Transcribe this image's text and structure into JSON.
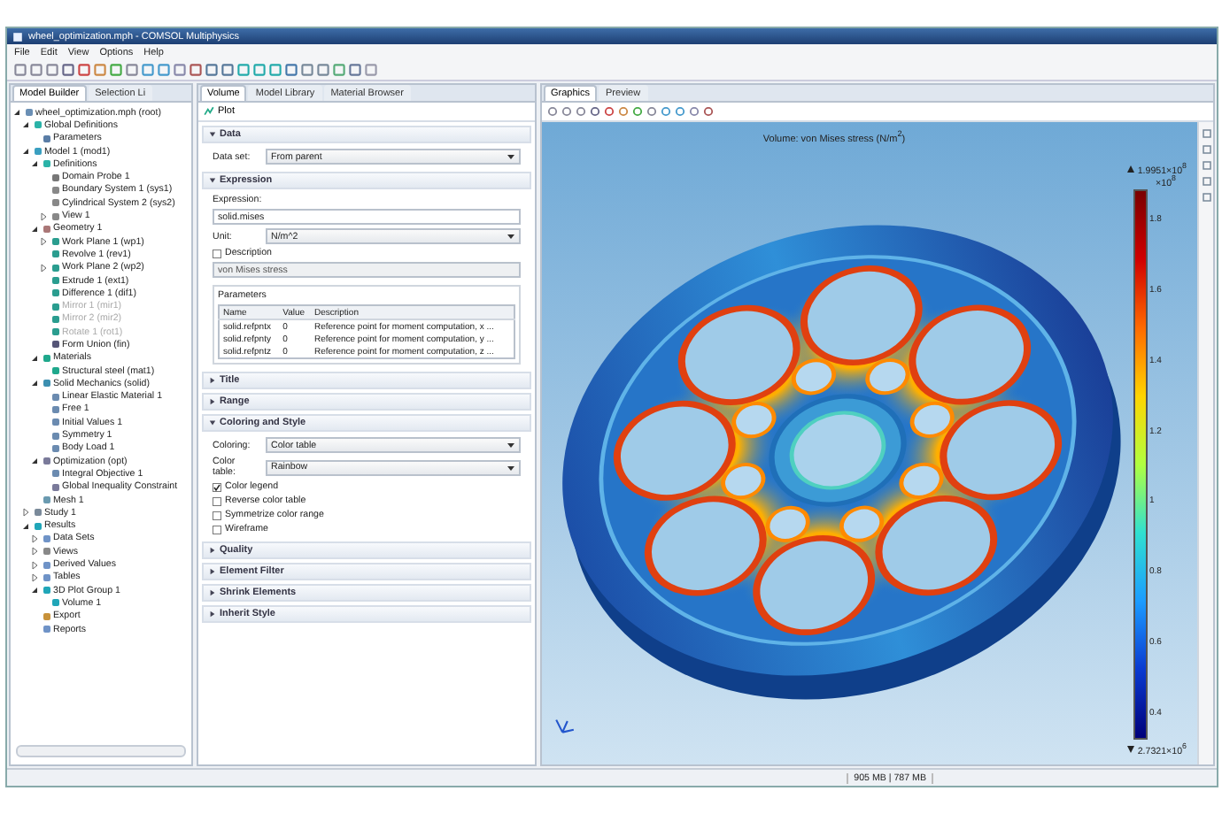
{
  "window": {
    "title": "wheel_optimization.mph - COMSOL Multiphysics"
  },
  "menu": [
    "File",
    "Edit",
    "View",
    "Options",
    "Help"
  ],
  "left_panel": {
    "tabs": [
      {
        "label": "Model Builder",
        "selected": true
      },
      {
        "label": "Selection Li",
        "selected": false
      }
    ],
    "tree": [
      {
        "label": "wheel_optimization.mph (root)",
        "kind": "file",
        "expanded": true,
        "children": [
          {
            "label": "Global Definitions",
            "kind": "globe",
            "expanded": true,
            "children": [
              {
                "label": "Parameters",
                "kind": "param"
              }
            ]
          },
          {
            "label": "Model 1 (mod1)",
            "kind": "model",
            "expanded": true,
            "children": [
              {
                "label": "Definitions",
                "kind": "globe",
                "expanded": true,
                "children": [
                  {
                    "label": "Domain Probe 1",
                    "kind": "probe"
                  },
                  {
                    "label": "Boundary System 1 (sys1)",
                    "kind": "axes"
                  },
                  {
                    "label": "Cylindrical System 2 (sys2)",
                    "kind": "axes"
                  },
                  {
                    "label": "View 1",
                    "kind": "axes",
                    "expanded": false
                  }
                ]
              },
              {
                "label": "Geometry 1",
                "kind": "geometry",
                "expanded": true,
                "children": [
                  {
                    "label": "Work Plane 1 (wp1)",
                    "kind": "feature",
                    "expanded": false,
                    "disabled": false
                  },
                  {
                    "label": "Revolve 1 (rev1)",
                    "kind": "feature",
                    "disabled": false
                  },
                  {
                    "label": "Work Plane 2 (wp2)",
                    "kind": "feature",
                    "expanded": false,
                    "disabled": false
                  },
                  {
                    "label": "Extrude 1 (ext1)",
                    "kind": "feature",
                    "disabled": false
                  },
                  {
                    "label": "Difference 1 (dif1)",
                    "kind": "feature",
                    "disabled": false
                  },
                  {
                    "label": "Mirror 1 (mir1)",
                    "kind": "feature",
                    "disabled": true
                  },
                  {
                    "label": "Mirror 2 (mir2)",
                    "kind": "feature",
                    "disabled": true
                  },
                  {
                    "label": "Rotate 1 (rot1)",
                    "kind": "feature",
                    "disabled": true
                  },
                  {
                    "label": "Form Union (fin)",
                    "kind": "union",
                    "disabled": false
                  }
                ]
              },
              {
                "label": "Materials",
                "kind": "material",
                "expanded": true,
                "children": [
                  {
                    "label": "Structural steel (mat1)",
                    "kind": "material"
                  }
                ]
              },
              {
                "label": "Solid Mechanics (solid)",
                "kind": "physics",
                "expanded": true,
                "children": [
                  {
                    "label": "Linear Elastic Material 1",
                    "kind": "node"
                  },
                  {
                    "label": "Free 1",
                    "kind": "node"
                  },
                  {
                    "label": "Initial Values 1",
                    "kind": "node"
                  },
                  {
                    "label": "Symmetry 1",
                    "kind": "node"
                  },
                  {
                    "label": "Body Load 1",
                    "kind": "node"
                  }
                ]
              },
              {
                "label": "Optimization (opt)",
                "kind": "opt",
                "expanded": true,
                "children": [
                  {
                    "label": "Integral Objective 1",
                    "kind": "node"
                  },
                  {
                    "label": "Global Inequality Constraint",
                    "kind": "opt"
                  }
                ]
              },
              {
                "label": "Mesh 1",
                "kind": "mesh"
              }
            ]
          },
          {
            "label": "Study 1",
            "kind": "study",
            "expanded": false
          },
          {
            "label": "Results",
            "kind": "results",
            "expanded": true,
            "children": [
              {
                "label": "Data Sets",
                "kind": "table",
                "expanded": false
              },
              {
                "label": "Views",
                "kind": "axes",
                "expanded": false
              },
              {
                "label": "Derived Values",
                "kind": "table",
                "expanded": false
              },
              {
                "label": "Tables",
                "kind": "table",
                "expanded": false
              },
              {
                "label": "3D Plot Group 1",
                "kind": "results",
                "expanded": true,
                "children": [
                  {
                    "label": "Volume 1",
                    "kind": "results"
                  }
                ]
              },
              {
                "label": "Export",
                "kind": "export"
              },
              {
                "label": "Reports",
                "kind": "table"
              }
            ]
          }
        ]
      }
    ]
  },
  "settings": {
    "tabs": [
      {
        "label": "Volume",
        "selected": true
      },
      {
        "label": "Model Library",
        "selected": false
      },
      {
        "label": "Material Browser",
        "selected": false
      }
    ],
    "plot_button": "Plot",
    "sections": [
      {
        "title": "Data",
        "expanded": true,
        "fields": [
          {
            "kind": "select",
            "label": "Data set:",
            "value": "From parent"
          }
        ]
      },
      {
        "title": "Expression",
        "expanded": true,
        "fields": [
          {
            "kind": "text",
            "label": "Expression:",
            "value": "solid.mises"
          },
          {
            "kind": "select",
            "label": "Unit:",
            "value": "N/m^2"
          },
          {
            "kind": "checkbox",
            "label": "Description",
            "checked": false
          },
          {
            "kind": "text",
            "value": "von Mises stress",
            "disabled": true
          },
          {
            "kind": "table",
            "label": "Parameters",
            "columns": [
              "Name",
              "Value",
              "Description"
            ],
            "rows": [
              [
                "solid.refpntx",
                "0",
                "Reference point for moment computation, x ..."
              ],
              [
                "solid.refpnty",
                "0",
                "Reference point for moment computation, y ..."
              ],
              [
                "solid.refpntz",
                "0",
                "Reference point for moment computation, z ..."
              ]
            ]
          }
        ]
      },
      {
        "title": "Title",
        "expanded": false
      },
      {
        "title": "Range",
        "expanded": false
      },
      {
        "title": "Coloring and Style",
        "expanded": true,
        "fields": [
          {
            "kind": "select",
            "label": "Coloring:",
            "value": "Color table"
          },
          {
            "kind": "select",
            "label": "Color table:",
            "value": "Rainbow"
          },
          {
            "kind": "checkbox",
            "label": "Color legend",
            "checked": true
          },
          {
            "kind": "checkbox",
            "label": "Reverse color table",
            "checked": false
          },
          {
            "kind": "checkbox",
            "label": "Symmetrize color range",
            "checked": false
          },
          {
            "kind": "checkbox",
            "label": "Wireframe",
            "checked": false
          }
        ]
      },
      {
        "title": "Quality",
        "expanded": false
      },
      {
        "title": "Element Filter",
        "expanded": false
      },
      {
        "title": "Shrink Elements",
        "expanded": false
      },
      {
        "title": "Inherit Style",
        "expanded": false
      }
    ]
  },
  "graphics": {
    "tabs": [
      {
        "label": "Graphics",
        "selected": true
      },
      {
        "label": "Preview",
        "selected": false
      }
    ],
    "plot_title": "Volume: von Mises stress (N/m$^{2}$)",
    "legend": {
      "max": "1.9951×10$^{8}$",
      "multiplier": "×10$^{8}$",
      "ticks": [
        "1.8",
        "1.6",
        "1.4",
        "1.2",
        "1",
        "0.8",
        "0.6",
        "0.4"
      ],
      "min": "2.7321×10$^{6}$"
    }
  },
  "status_bar": {
    "memory": "905 MB | 787 MB"
  }
}
